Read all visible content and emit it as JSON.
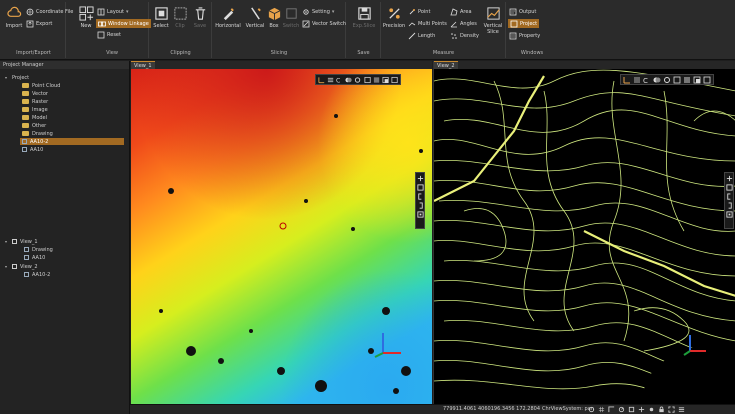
{
  "ribbon": {
    "import_export": {
      "label": "Import/Export",
      "import": "Import",
      "coordinate_file": "Coordinate File",
      "export": "Export"
    },
    "view": {
      "label": "View",
      "new": "New",
      "layout": "Layout",
      "window_linkage": "Window Linkage",
      "reset": "Reset"
    },
    "clipping": {
      "label": "Clipping",
      "select": "Select",
      "clip": "Clip",
      "save": "Save"
    },
    "slicing": {
      "label": "Slicing",
      "horizontal": "Horizontal",
      "vertical": "Vertical",
      "box": "Box",
      "switch": "Switch",
      "setting": "Setting",
      "vector_switch": "Vector Switch"
    },
    "save_group": {
      "label": "Save",
      "exp_slice": "Exp.Slice"
    },
    "measure": {
      "label": "Measure",
      "precision": "Precision",
      "point": "Point",
      "multi_points": "Multi Points",
      "length": "Length",
      "area": "Area",
      "angles": "Angles",
      "density": "Density",
      "vertical_slice_line1": "Vertical",
      "vertical_slice_line2": "Slice"
    },
    "windows": {
      "label": "Windows",
      "output": "Output",
      "project": "Project",
      "property": "Property"
    }
  },
  "project_manager": {
    "title": "Project Manager",
    "project": {
      "label": "Project",
      "children": [
        "Point Cloud",
        "Vector",
        "Raster",
        "Image",
        "Model",
        "Other",
        "Drawing",
        "AA10-2",
        "AA10"
      ]
    },
    "views": [
      {
        "label": "View_1",
        "children": [
          "Drawing",
          "AA10"
        ]
      },
      {
        "label": "View_2",
        "children": [
          "AA10-2"
        ]
      }
    ]
  },
  "views": {
    "view1_tab": "View_1",
    "view2_tab": "View_2"
  },
  "status": {
    "coords": "779911.4061 4060196.3456 172.2804",
    "view_system": "ChrViewSystem: pan"
  },
  "colors": {
    "accent": "#a26a22",
    "contour": "#d8f08a",
    "folder": "#d9b34e"
  }
}
